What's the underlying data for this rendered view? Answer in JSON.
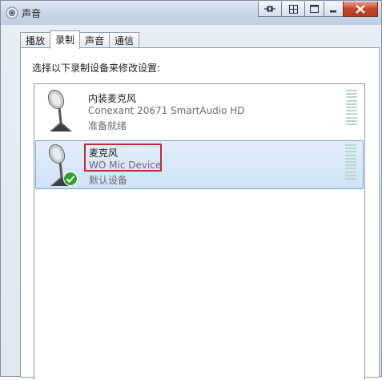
{
  "window": {
    "title": "声音"
  },
  "tabs": [
    {
      "label": "播放",
      "active": false
    },
    {
      "label": "录制",
      "active": true
    },
    {
      "label": "声音",
      "active": false
    },
    {
      "label": "通信",
      "active": false
    }
  ],
  "instruction": "选择以下录制设备来修改设置:",
  "devices": [
    {
      "name": "内装麦克风",
      "description": "Conexant 20671 SmartAudio HD",
      "status": "准备就绪",
      "selected": false,
      "is_default": false
    },
    {
      "name": "麦克风",
      "description": "WO Mic Device",
      "status": "默认设备",
      "selected": true,
      "is_default": true
    }
  ],
  "colors": {
    "highlight_border": "#c22b33",
    "selection": "#cfe2f8",
    "check": "#2fa32f"
  }
}
